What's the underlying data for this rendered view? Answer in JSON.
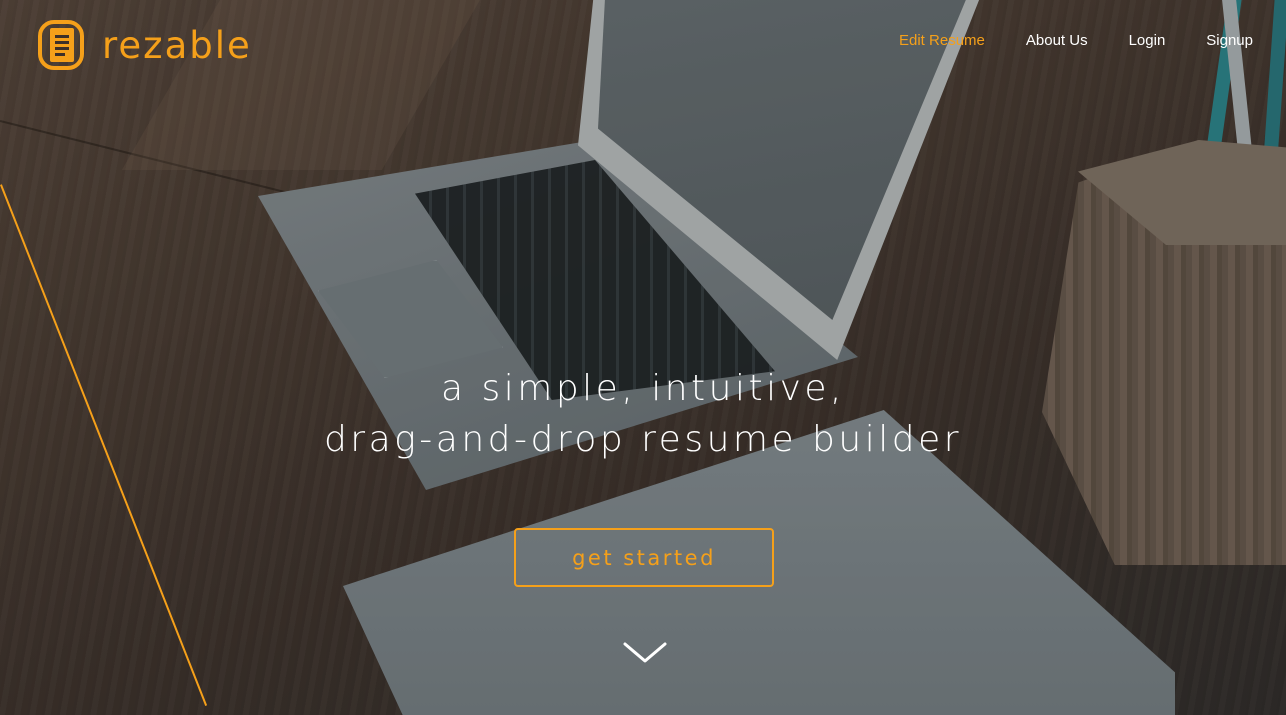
{
  "brand": {
    "name": "rezable"
  },
  "nav": {
    "items": [
      {
        "label": "Edit Resume",
        "active": true
      },
      {
        "label": "About Us",
        "active": false
      },
      {
        "label": "Login",
        "active": false
      },
      {
        "label": "Signup",
        "active": false
      }
    ]
  },
  "hero": {
    "headline_line1": "a simple, intuitive,",
    "headline_line2": "drag-and-drop resume builder",
    "cta_label": "get started",
    "scroll_icon": "chevron-down-icon"
  },
  "colors": {
    "accent": "#f5a01a",
    "nav_text": "#ffffff",
    "headline_text": "#ffffff"
  }
}
